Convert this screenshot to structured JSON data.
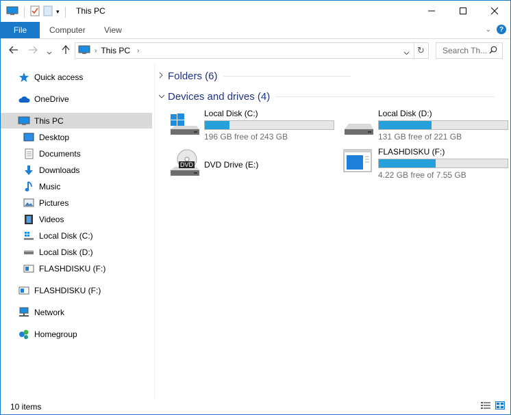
{
  "window": {
    "title": "This PC"
  },
  "ribbon": {
    "file": "File",
    "tabs": [
      "Computer",
      "View"
    ]
  },
  "address": {
    "path": "This PC"
  },
  "search": {
    "placeholder": "Search Th..."
  },
  "nav": {
    "items": [
      {
        "label": "Quick access"
      },
      {
        "label": "OneDrive"
      },
      {
        "label": "This PC"
      },
      {
        "label": "Desktop"
      },
      {
        "label": "Documents"
      },
      {
        "label": "Downloads"
      },
      {
        "label": "Music"
      },
      {
        "label": "Pictures"
      },
      {
        "label": "Videos"
      },
      {
        "label": "Local Disk (C:)"
      },
      {
        "label": "Local Disk (D:)"
      },
      {
        "label": "FLASHDISKU (F:)"
      },
      {
        "label": "FLASHDISKU (F:)"
      },
      {
        "label": "Network"
      },
      {
        "label": "Homegroup"
      }
    ]
  },
  "groups": {
    "folders": "Folders (6)",
    "devices": "Devices and drives (4)"
  },
  "drives": [
    {
      "name": "Local Disk (C:)",
      "free": "196 GB free of 243 GB",
      "used_fraction": 0.19
    },
    {
      "name": "Local Disk (D:)",
      "free": "131 GB free of 221 GB",
      "used_fraction": 0.41
    },
    {
      "name": "DVD Drive (E:)",
      "dvd_label": "DVD"
    },
    {
      "name": "FLASHDISKU (F:)",
      "free": "4.22 GB free of 7.55 GB",
      "used_fraction": 0.44
    }
  ],
  "status": {
    "items": "10 items"
  },
  "colors": {
    "accent": "#1979ca",
    "bar_fill": "#26a0da",
    "group_heading": "#1e3287"
  }
}
